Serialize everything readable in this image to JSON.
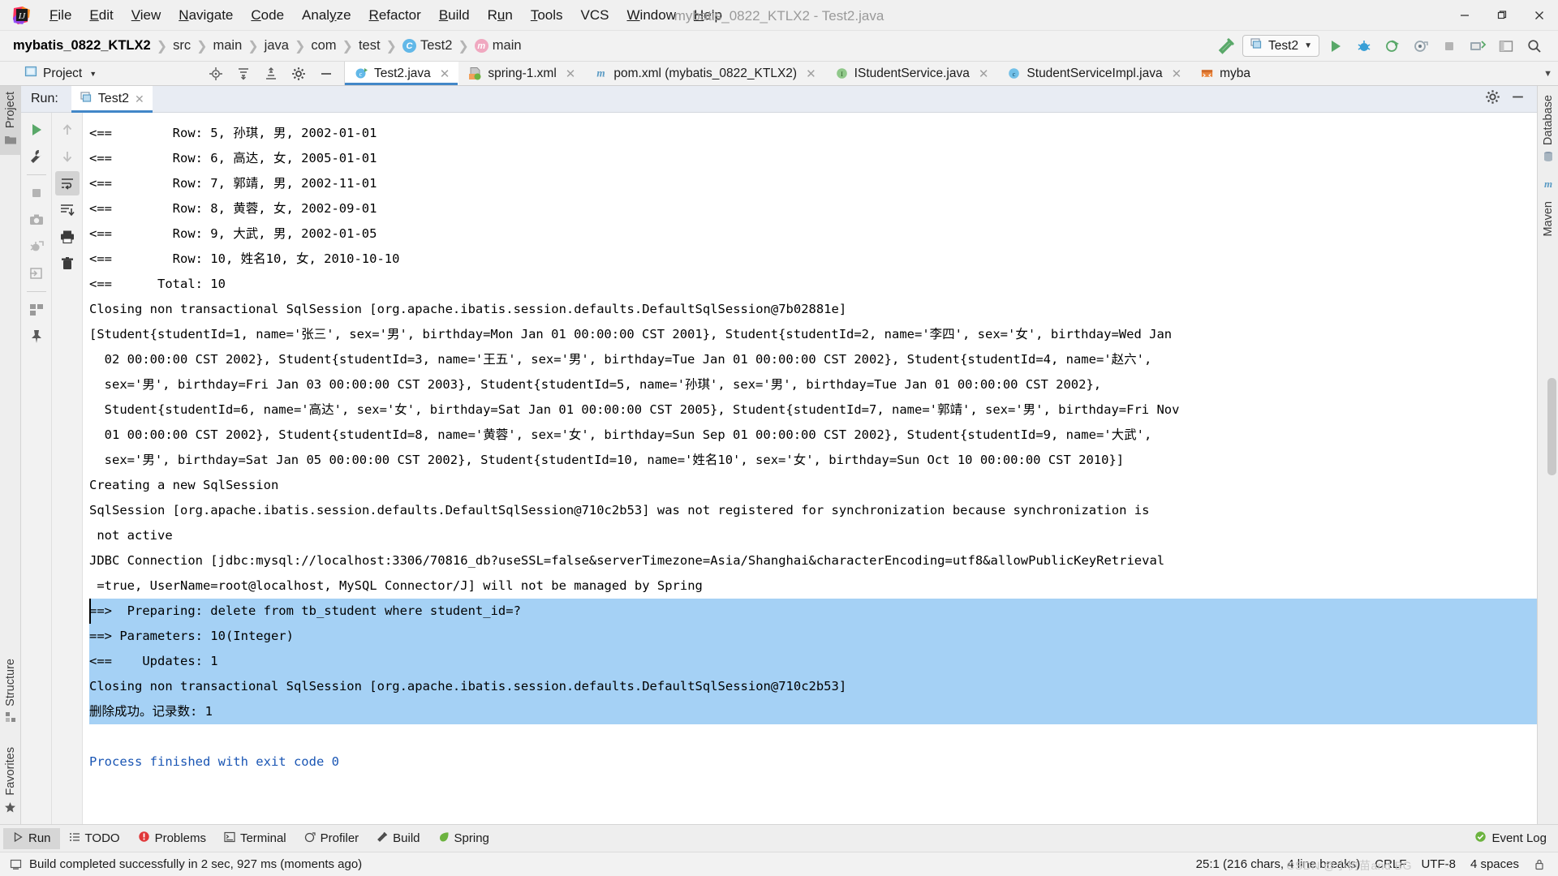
{
  "window": {
    "title": "mybatis_0822_KTLX2 - Test2.java",
    "logo_icon": "intellij-idea-logo",
    "minimize_icon": "minimize-icon",
    "maximize_icon": "maximize-icon",
    "close_icon": "close-icon"
  },
  "menubar": [
    {
      "label": "File",
      "mnemonic": "F"
    },
    {
      "label": "Edit",
      "mnemonic": "E"
    },
    {
      "label": "View",
      "mnemonic": "V"
    },
    {
      "label": "Navigate",
      "mnemonic": "N"
    },
    {
      "label": "Code",
      "mnemonic": "C"
    },
    {
      "label": "Analyze",
      "mnemonic": "y"
    },
    {
      "label": "Refactor",
      "mnemonic": "R"
    },
    {
      "label": "Build",
      "mnemonic": "B"
    },
    {
      "label": "Run",
      "mnemonic": "u"
    },
    {
      "label": "Tools",
      "mnemonic": "T"
    },
    {
      "label": "VCS",
      "mnemonic": ""
    },
    {
      "label": "Window",
      "mnemonic": "W"
    },
    {
      "label": "Help",
      "mnemonic": "H"
    }
  ],
  "breadcrumb": [
    {
      "label": "mybatis_0822_KTLX2",
      "icon": ""
    },
    {
      "label": "src",
      "icon": ""
    },
    {
      "label": "main",
      "icon": ""
    },
    {
      "label": "java",
      "icon": ""
    },
    {
      "label": "com",
      "icon": ""
    },
    {
      "label": "test",
      "icon": ""
    },
    {
      "label": "Test2",
      "icon": "class-icon",
      "icon_letter": "C",
      "icon_color": "#62b8e8"
    },
    {
      "label": "main",
      "icon": "method-icon",
      "icon_letter": "m",
      "icon_color": "#f0a8c0"
    }
  ],
  "toolbar": {
    "build_icon": "hammer-icon",
    "run_config_label": "Test2",
    "run_config_icon": "run-configuration-icon",
    "run_icon": "run-play-icon",
    "debug_icon": "debug-bug-icon",
    "coverage_icon": "run-with-coverage-icon",
    "profile_icon": "profile-icon",
    "stop_icon": "stop-icon",
    "vcs_update_icon": "vcs-update-icon",
    "search_everywhere_icon": "search-icon",
    "settings_icon": "gear-icon"
  },
  "project_panel": {
    "title": "Project",
    "title_icon": "project-icon",
    "dropdown_icon": "chevron-down-icon",
    "locate_icon": "locate-target-icon",
    "collapse_icon": "collapse-all-icon",
    "expand_icon": "expand-all-icon",
    "settings_icon": "gear-icon",
    "hide_icon": "minimize-icon"
  },
  "editor_tabs": [
    {
      "label": "Test2.java",
      "icon": "java-class-runnable-icon",
      "active": true,
      "closable": true
    },
    {
      "label": "spring-1.xml",
      "icon": "spring-xml-icon",
      "active": false,
      "closable": true
    },
    {
      "label": "pom.xml (mybatis_0822_KTLX2)",
      "icon": "maven-pom-icon",
      "active": false,
      "closable": true
    },
    {
      "label": "IStudentService.java",
      "icon": "java-interface-icon",
      "active": false,
      "closable": true
    },
    {
      "label": "StudentServiceImpl.java",
      "icon": "java-class-icon",
      "active": false,
      "closable": true
    },
    {
      "label": "myba",
      "icon": "xml-mapper-icon",
      "active": false,
      "closable": false
    }
  ],
  "editor_tabs_overflow_icon": "chevron-down-icon",
  "left_toolwindows": [
    {
      "label": "Project",
      "icon": "folder-icon",
      "active": true
    },
    {
      "label": "Structure",
      "icon": "structure-icon",
      "active": false
    },
    {
      "label": "Favorites",
      "icon": "star-icon",
      "active": false
    }
  ],
  "right_toolwindows": [
    {
      "label": "Database",
      "icon": "database-icon"
    },
    {
      "label": "Maven",
      "icon": "maven-m-icon"
    }
  ],
  "run_window": {
    "label": "Run:",
    "tab_label": "Test2",
    "tab_icon": "run-configuration-icon",
    "tab_close_icon": "close-icon",
    "settings_icon": "gear-icon",
    "hide_icon": "minimize-icon",
    "left_buttons": [
      {
        "icon": "rerun-play-icon",
        "name": "rerun-button",
        "selected": false
      },
      {
        "icon": "wrench-icon",
        "name": "edit-configuration-button",
        "selected": false
      },
      {
        "icon": "stop-square-icon",
        "name": "stop-button",
        "selected": false
      },
      {
        "icon": "camera-icon",
        "name": "snapshot-button",
        "selected": false
      },
      {
        "icon": "dump-threads-icon",
        "name": "dump-threads-button",
        "selected": false
      },
      {
        "icon": "export-icon",
        "name": "export-button",
        "selected": false
      },
      {
        "icon": "layout-icon",
        "name": "restore-layout-button",
        "selected": false
      },
      {
        "icon": "pin-icon",
        "name": "pin-tab-button",
        "selected": false
      }
    ],
    "right_buttons": [
      {
        "icon": "arrow-up-icon",
        "name": "previous-occurrence-button",
        "selected": false
      },
      {
        "icon": "arrow-down-icon",
        "name": "next-occurrence-button",
        "selected": false
      },
      {
        "icon": "soft-wrap-icon",
        "name": "soft-wrap-button",
        "selected": true
      },
      {
        "icon": "scroll-to-end-icon",
        "name": "scroll-to-end-button",
        "selected": false
      },
      {
        "icon": "print-icon",
        "name": "print-button",
        "selected": false
      },
      {
        "icon": "trash-icon",
        "name": "clear-all-button",
        "selected": false
      }
    ]
  },
  "console": {
    "lines": [
      {
        "text": "<==        Row: 5, 孙琪, 男, 2002-01-01",
        "highlight": false,
        "color": "black"
      },
      {
        "text": "<==        Row: 6, 高达, 女, 2005-01-01",
        "highlight": false,
        "color": "black"
      },
      {
        "text": "<==        Row: 7, 郭靖, 男, 2002-11-01",
        "highlight": false,
        "color": "black"
      },
      {
        "text": "<==        Row: 8, 黄蓉, 女, 2002-09-01",
        "highlight": false,
        "color": "black"
      },
      {
        "text": "<==        Row: 9, 大武, 男, 2002-01-05",
        "highlight": false,
        "color": "black"
      },
      {
        "text": "<==        Row: 10, 姓名10, 女, 2010-10-10",
        "highlight": false,
        "color": "black"
      },
      {
        "text": "<==      Total: 10",
        "highlight": false,
        "color": "black"
      },
      {
        "text": "Closing non transactional SqlSession [org.apache.ibatis.session.defaults.DefaultSqlSession@7b02881e]",
        "highlight": false,
        "color": "black"
      },
      {
        "text": "[Student{studentId=1, name='张三', sex='男', birthday=Mon Jan 01 00:00:00 CST 2001}, Student{studentId=2, name='李四', sex='女', birthday=Wed Jan",
        "highlight": false,
        "color": "black"
      },
      {
        "text": "  02 00:00:00 CST 2002}, Student{studentId=3, name='王五', sex='男', birthday=Tue Jan 01 00:00:00 CST 2002}, Student{studentId=4, name='赵六',",
        "highlight": false,
        "color": "black"
      },
      {
        "text": "  sex='男', birthday=Fri Jan 03 00:00:00 CST 2003}, Student{studentId=5, name='孙琪', sex='男', birthday=Tue Jan 01 00:00:00 CST 2002},",
        "highlight": false,
        "color": "black"
      },
      {
        "text": "  Student{studentId=6, name='高达', sex='女', birthday=Sat Jan 01 00:00:00 CST 2005}, Student{studentId=7, name='郭靖', sex='男', birthday=Fri Nov",
        "highlight": false,
        "color": "black"
      },
      {
        "text": "  01 00:00:00 CST 2002}, Student{studentId=8, name='黄蓉', sex='女', birthday=Sun Sep 01 00:00:00 CST 2002}, Student{studentId=9, name='大武',",
        "highlight": false,
        "color": "black"
      },
      {
        "text": "  sex='男', birthday=Sat Jan 05 00:00:00 CST 2002}, Student{studentId=10, name='姓名10', sex='女', birthday=Sun Oct 10 00:00:00 CST 2010}]",
        "highlight": false,
        "color": "black"
      },
      {
        "text": "Creating a new SqlSession",
        "highlight": false,
        "color": "black"
      },
      {
        "text": "SqlSession [org.apache.ibatis.session.defaults.DefaultSqlSession@710c2b53] was not registered for synchronization because synchronization is",
        "highlight": false,
        "color": "black"
      },
      {
        "text": " not active",
        "highlight": false,
        "color": "black"
      },
      {
        "text": "JDBC Connection [jdbc:mysql://localhost:3306/70816_db?useSSL=false&serverTimezone=Asia/Shanghai&characterEncoding=utf8&allowPublicKeyRetrieval",
        "highlight": false,
        "color": "black"
      },
      {
        "text": " =true, UserName=root@localhost, MySQL Connector/J] will not be managed by Spring",
        "highlight": false,
        "color": "black"
      },
      {
        "text": "==>  Preparing: delete from tb_student where student_id=?",
        "highlight": true,
        "color": "black",
        "caret": true
      },
      {
        "text": "==> Parameters: 10(Integer)",
        "highlight": true,
        "color": "black"
      },
      {
        "text": "<==    Updates: 1",
        "highlight": true,
        "color": "black"
      },
      {
        "text": "Closing non transactional SqlSession [org.apache.ibatis.session.defaults.DefaultSqlSession@710c2b53]",
        "highlight": true,
        "color": "black"
      },
      {
        "text": "删除成功。记录数: 1",
        "highlight": true,
        "color": "black"
      },
      {
        "text": "",
        "highlight": false,
        "color": "black"
      },
      {
        "text": "Process finished with exit code 0",
        "highlight": false,
        "color": "blue"
      }
    ],
    "selection_color": "#a5d1f5",
    "blue_text_color": "#1a56b4"
  },
  "bottom_tabs": [
    {
      "label": "Run",
      "icon": "run-play-icon",
      "active": true
    },
    {
      "label": "TODO",
      "icon": "todo-list-icon",
      "active": false
    },
    {
      "label": "Problems",
      "icon": "problems-error-icon",
      "active": false
    },
    {
      "label": "Terminal",
      "icon": "terminal-icon",
      "active": false
    },
    {
      "label": "Profiler",
      "icon": "profiler-icon",
      "active": false
    },
    {
      "label": "Build",
      "icon": "build-hammer-icon",
      "active": false
    },
    {
      "label": "Spring",
      "icon": "spring-leaf-icon",
      "active": false
    }
  ],
  "event_log": {
    "label": "Event Log",
    "icon": "event-log-icon"
  },
  "statusbar": {
    "message": "Build completed successfully in 2 sec, 927 ms (moments ago)",
    "message_icon": "notification-icon",
    "caret_position": "25:1 (216 chars, 4 line breaks)",
    "line_separator": "CRLF",
    "encoding": "UTF-8",
    "indent": "4 spaces",
    "watermark": "CSDN @小树苗and BG"
  }
}
